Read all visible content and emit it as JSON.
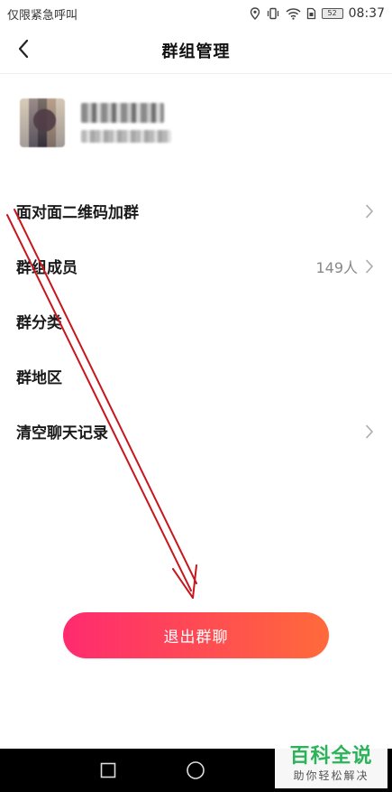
{
  "status_bar": {
    "carrier_text": "仅限紧急呼叫",
    "battery_level": "52",
    "time": "08:37",
    "icons": [
      "location-icon",
      "vibrate-icon",
      "wifi-icon",
      "sim-icon",
      "battery-icon"
    ]
  },
  "header": {
    "title": "群组管理",
    "back_icon": "chevron-left-icon"
  },
  "group_info": {
    "avatar": "pixelated-avatar",
    "name": "",
    "id": ""
  },
  "menu": {
    "items": [
      {
        "label": "面对面二维码加群",
        "value": "",
        "has_chevron": true
      },
      {
        "label": "群组成员",
        "value": "149人",
        "has_chevron": true
      },
      {
        "label": "群分类",
        "value": "",
        "has_chevron": false
      },
      {
        "label": "群地区",
        "value": "",
        "has_chevron": false
      },
      {
        "label": "清空聊天记录",
        "value": "",
        "has_chevron": true
      }
    ]
  },
  "exit_button": {
    "label": "退出群聊",
    "gradient_start": "#ff2a6f",
    "gradient_end": "#ff6a3a"
  },
  "annotation": {
    "color": "#c8161d",
    "shape": "arrow-pointing-down"
  },
  "nav_bar": {
    "buttons": [
      "recent-apps-icon",
      "home-icon"
    ]
  },
  "watermark": {
    "main": "百科全说",
    "sub": "助你轻松解决",
    "color": "#2bb35a"
  }
}
